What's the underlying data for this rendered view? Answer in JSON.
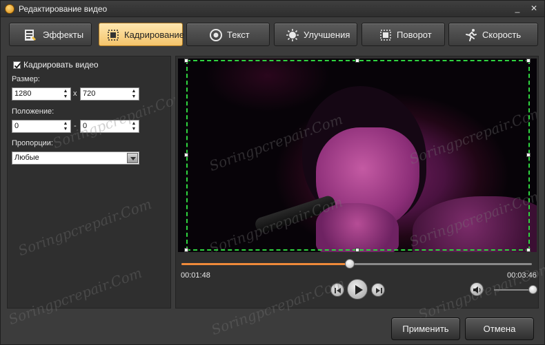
{
  "window": {
    "title": "Редактирование видео",
    "minimize": "_",
    "close": "✕"
  },
  "tabs": [
    {
      "label": "Эффекты",
      "icon": "effects-icon",
      "active": false
    },
    {
      "label": "Кадрирование",
      "icon": "crop-icon",
      "active": true
    },
    {
      "label": "Текст",
      "icon": "text-icon",
      "active": false
    },
    {
      "label": "Улучшения",
      "icon": "enhance-icon",
      "active": false
    },
    {
      "label": "Поворот",
      "icon": "rotate-icon",
      "active": false
    },
    {
      "label": "Скорость",
      "icon": "speed-icon",
      "active": false
    }
  ],
  "crop": {
    "checkbox_label": "Кадрировать видео",
    "checked": true,
    "size_label": "Размер:",
    "width": "1280",
    "height": "720",
    "size_sep": "x",
    "position_label": "Положение:",
    "pos_x": "0",
    "pos_y": "0",
    "pos_sep": "-",
    "aspect_label": "Пропорции:",
    "aspect_value": "Любые"
  },
  "player": {
    "current_time": "00:01:48",
    "total_time": "00:03:46",
    "progress": 0.48,
    "volume": 1.0
  },
  "watermark_text": "Soringpcrepair.Com",
  "buttons": {
    "apply": "Применить",
    "cancel": "Отмена"
  },
  "colors": {
    "accent": "#ef8a3a",
    "active_tab": "#f4c46b",
    "crop_border": "#2fd640"
  }
}
